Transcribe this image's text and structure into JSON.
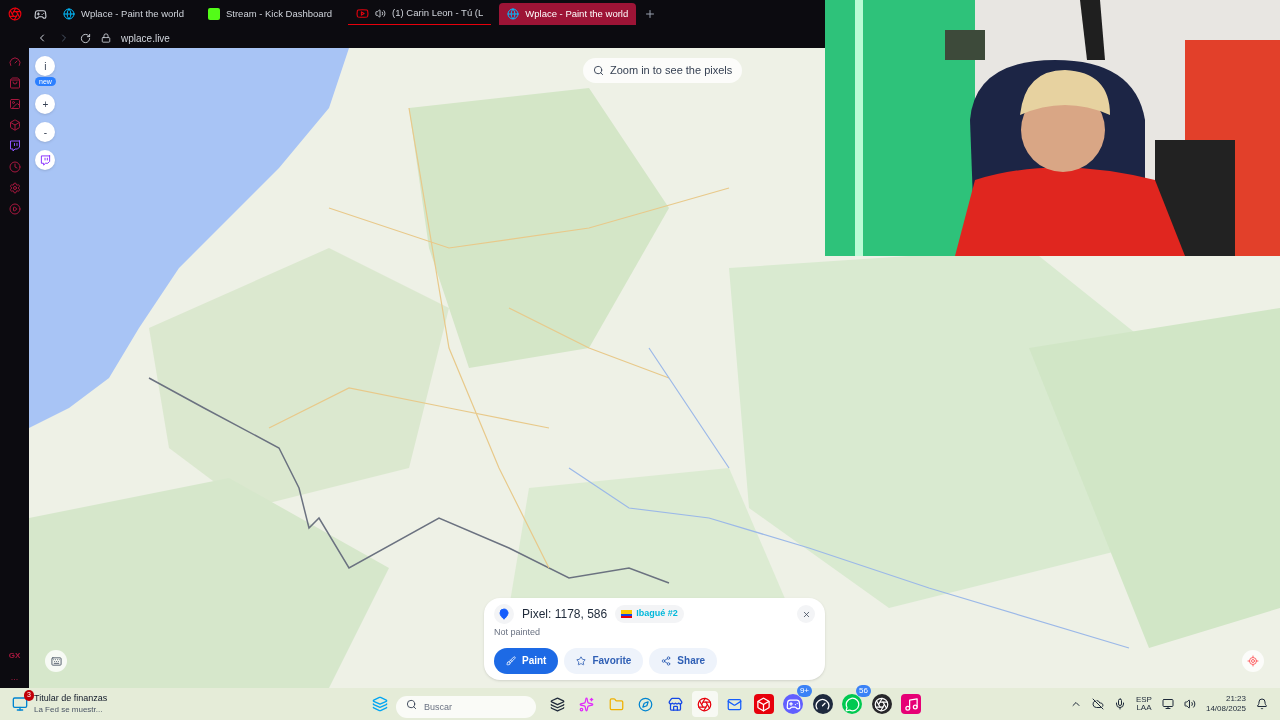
{
  "browser": {
    "tabs": [
      {
        "title": "Wplace - Paint the world",
        "kind": "globe",
        "selected": false,
        "audio": false
      },
      {
        "title": "Stream - Kick Dashboard",
        "kind": "kick",
        "selected": false,
        "audio": false
      },
      {
        "title": "(1) Carin Leon - Tú (L",
        "kind": "youtube",
        "selected": false,
        "audio": true
      },
      {
        "title": "Wplace - Paint the world",
        "kind": "globe",
        "selected": true,
        "audio": false
      }
    ],
    "address": "wplace.live"
  },
  "sidebar": {
    "brand": "GX",
    "more": "..."
  },
  "map": {
    "info_button": "i",
    "info_badge": "new",
    "zoom_in": "+",
    "zoom_out": "-",
    "hint": "Zoom in to see the pixels"
  },
  "pixel_card": {
    "title": "Pixel: 1178, 586",
    "region": "Ibagué #2",
    "status": "Not painted",
    "buttons": [
      {
        "label": "Paint",
        "kind": "primary"
      },
      {
        "label": "Favorite",
        "kind": "secondary"
      },
      {
        "label": "Share",
        "kind": "secondary"
      }
    ]
  },
  "taskbar": {
    "news_badge": "3",
    "news_title": "Titular de finanzas",
    "news_text": "La Fed se muestr...",
    "search_placeholder": "Buscar",
    "apps": [
      {
        "kind": "taskview"
      },
      {
        "kind": "copilot"
      },
      {
        "kind": "folder"
      },
      {
        "kind": "edge"
      },
      {
        "kind": "store"
      },
      {
        "kind": "opera",
        "selected": true
      },
      {
        "kind": "outlook"
      },
      {
        "kind": "wps"
      },
      {
        "kind": "discord",
        "badge": "9+"
      },
      {
        "kind": "steam"
      },
      {
        "kind": "whatsapp",
        "badge": "56"
      },
      {
        "kind": "obs"
      },
      {
        "kind": "tiktok"
      }
    ],
    "language": "ESP",
    "layout": "LAA",
    "time": "21:23",
    "date": "14/08/2025"
  }
}
